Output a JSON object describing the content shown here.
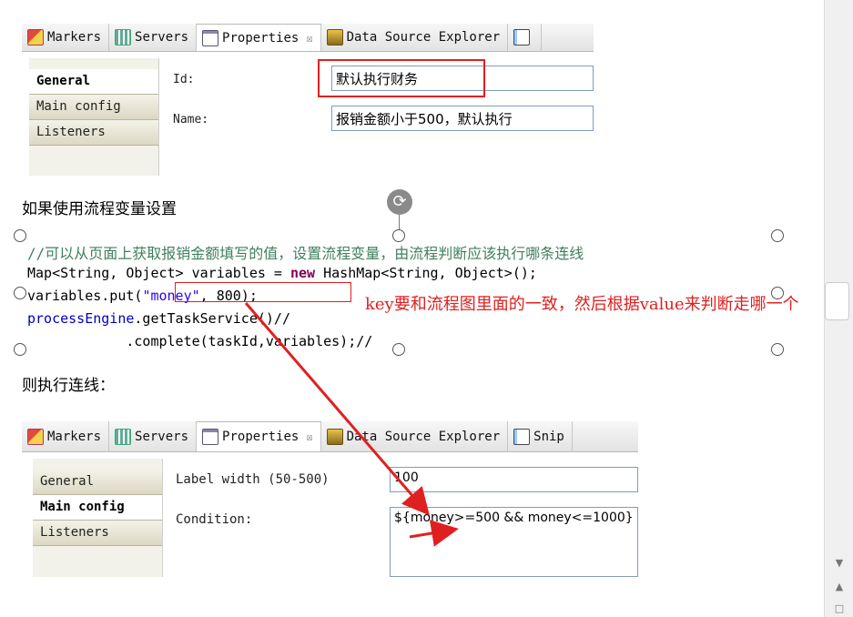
{
  "top_panel": {
    "tabs": [
      {
        "label": "Markers",
        "icon": "markers-icon"
      },
      {
        "label": "Servers",
        "icon": "servers-icon"
      },
      {
        "label": "Properties",
        "icon": "properties-icon",
        "close": "☒"
      },
      {
        "label": "Data Source Explorer",
        "icon": "data-source-icon"
      },
      {
        "label": "",
        "icon": "snippets-icon"
      }
    ],
    "side_tabs": [
      "General",
      "Main config",
      "Listeners"
    ],
    "id_label": "Id:",
    "id_value": "默认执行财务",
    "name_label": "Name:",
    "name_value": "报销金额小于500，默认执行"
  },
  "heading1": "如果使用流程变量设置",
  "code": {
    "line1": "//可以从页面上获取报销金额填写的值，设置流程变量，由流程判断应该执行哪条连线",
    "line2_a": "Map<String, Object> variables = ",
    "line2_kw": "new",
    "line2_b": " HashMap<String, Object>();",
    "line3_a": "variables.put(",
    "line3_str": "\"money\"",
    "line3_b": ", 800);",
    "line4_a": "processEngine",
    "line4_b": ".getTaskService()//",
    "line5": "            .complete(taskId,variables);//"
  },
  "annotation": "key要和流程图里面的一致，然后根据value来判断走哪一个",
  "heading2": "则执行连线：",
  "bottom_panel": {
    "tabs": [
      {
        "label": "Markers",
        "icon": "markers-icon"
      },
      {
        "label": "Servers",
        "icon": "servers-icon"
      },
      {
        "label": "Properties",
        "icon": "properties-icon",
        "close": "☒"
      },
      {
        "label": "Data Source Explorer",
        "icon": "data-source-icon"
      },
      {
        "label": "Snip",
        "icon": "snippets-icon"
      }
    ],
    "side_tabs": [
      "General",
      "Main config",
      "Listeners"
    ],
    "label_width_label": "Label width (50-500)",
    "label_width_value": "100",
    "condition_label": "Condition:",
    "condition_value": "${money>=500 && money<=1000}"
  },
  "colors": {
    "annotation": "#e02020",
    "highlight_box": "#e02020",
    "comment": "#3f7f5f",
    "keyword": "#7f0055",
    "string": "#2a00ff"
  }
}
